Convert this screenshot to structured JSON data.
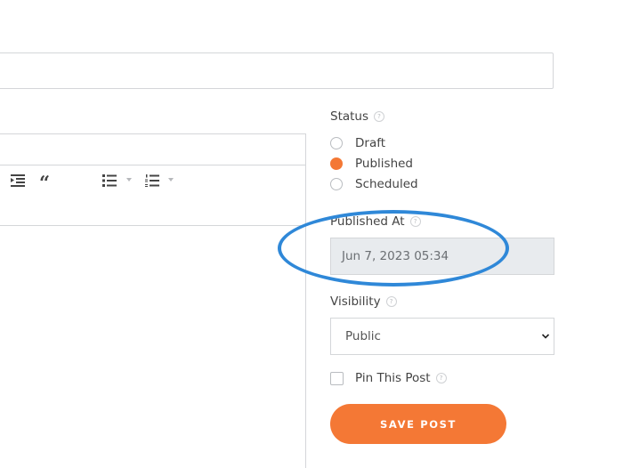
{
  "sidebar": {
    "status": {
      "label": "Status",
      "options": [
        {
          "label": "Draft",
          "checked": false
        },
        {
          "label": "Published",
          "checked": true
        },
        {
          "label": "Scheduled",
          "checked": false
        }
      ]
    },
    "published_at": {
      "label": "Published At",
      "value": "Jun 7, 2023 05:34"
    },
    "visibility": {
      "label": "Visibility",
      "selected": "Public"
    },
    "pin_post": {
      "label": "Pin This Post",
      "checked": false
    },
    "save_label": "SAVE POST"
  },
  "icons": {
    "help": "?"
  },
  "colors": {
    "accent": "#f47835",
    "annotation": "#2f88d8",
    "disabled_field": "#e8ebee",
    "border": "#d4d6d9"
  }
}
